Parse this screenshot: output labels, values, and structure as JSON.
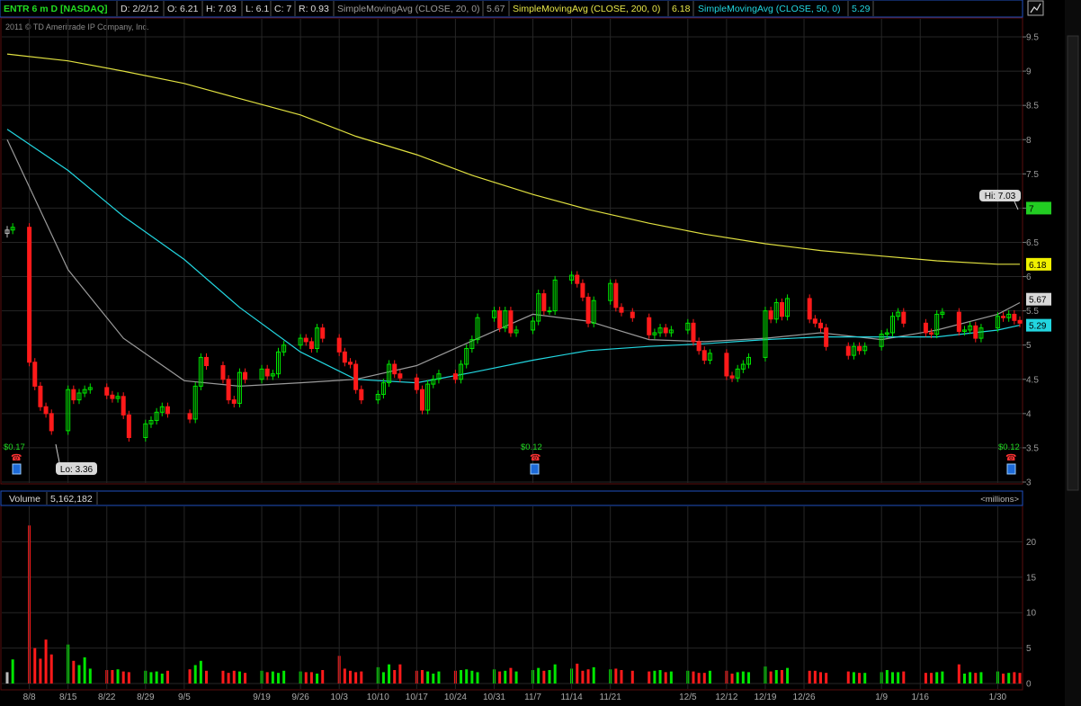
{
  "header": {
    "symbol": "ENTR 6 m D [NASDAQ]",
    "date": "D: 2/2/12",
    "open": "O: 6.21",
    "high": "H: 7.03",
    "low": "L: 6.1",
    "close": "C: 7",
    "range": "R: 0.93",
    "sma20_label": "SimpleMovingAvg (CLOSE, 20, 0)",
    "sma20_value": "5.67",
    "sma200_label": "SimpleMovingAvg (CLOSE, 200, 0)",
    "sma200_value": "6.18",
    "sma50_label": "SimpleMovingAvg (CLOSE, 50, 0)",
    "sma50_value": "5.29"
  },
  "copyright": "2011 © TD Ameritrade IP Company, Inc.",
  "volume_header": {
    "label": "Volume",
    "value": "5,162,182",
    "units": "<millions>"
  },
  "annotations": {
    "hi": "Hi: 7.03",
    "lo": "Lo: 3.36",
    "dividends": [
      "$0.17",
      "$0.12",
      "$0.12"
    ]
  },
  "price_tags": {
    "last": "7",
    "sma200": "6.18",
    "sma20": "5.67",
    "sma50": "5.29"
  },
  "colors": {
    "up": "#00e600",
    "down": "#ff1a1a",
    "neutral": "#bbbbbb",
    "sma20": "#9a9a9a",
    "sma50": "#22d6e0",
    "sma200": "#e0e040",
    "grid": "#262626",
    "border": "#5a0e0e"
  },
  "chart_data": [
    {
      "type": "candlestick",
      "title": "ENTR 6 m D [NASDAQ]",
      "ylim": [
        3,
        9.75
      ],
      "y_ticks": [
        "3",
        "3.5",
        "4",
        "4.5",
        "5",
        "5.5",
        "6",
        "6.5",
        "7",
        "7.5",
        "8",
        "8.5",
        "9",
        "9.5"
      ],
      "x_ticks": [
        "8/8",
        "8/15",
        "8/22",
        "8/29",
        "9/5",
        "9/19",
        "9/26",
        "10/3",
        "10/10",
        "10/17",
        "10/24",
        "10/31",
        "11/7",
        "11/14",
        "11/21",
        "12/5",
        "12/12",
        "12/19",
        "12/26",
        "1/9",
        "1/16",
        "1/30"
      ],
      "x_tick_dates": [
        "2011-08-08",
        "2011-08-15",
        "2011-08-22",
        "2011-08-29",
        "2011-09-05",
        "2011-09-19",
        "2011-09-26",
        "2011-10-03",
        "2011-10-10",
        "2011-10-17",
        "2011-10-24",
        "2011-10-31",
        "2011-11-07",
        "2011-11-14",
        "2011-11-21",
        "2011-12-05",
        "2011-12-12",
        "2011-12-19",
        "2011-12-26",
        "2012-01-09",
        "2012-01-16",
        "2012-01-30"
      ],
      "closes": [
        6.68,
        6.72,
        4.75,
        4.4,
        4.1,
        4.0,
        3.75,
        4.35,
        4.2,
        4.3,
        4.35,
        4.38,
        4.27,
        4.22,
        4.25,
        3.98,
        3.65,
        3.85,
        3.9,
        4.02,
        4.1,
        4.0,
        3.92,
        4.4,
        4.82,
        4.7,
        4.5,
        4.2,
        4.15,
        4.6,
        4.5,
        4.65,
        4.55,
        4.58,
        4.9,
        5.0,
        5.1,
        5.05,
        4.95,
        5.25,
        5.1,
        4.9,
        4.75,
        4.72,
        4.35,
        4.2,
        4.28,
        4.45,
        4.72,
        4.58,
        4.52,
        4.35,
        4.05,
        4.43,
        4.5,
        4.58,
        4.5,
        4.72,
        4.95,
        5.08,
        5.4,
        5.5,
        5.25,
        5.5,
        5.18,
        5.22,
        5.35,
        5.75,
        5.5,
        5.5,
        5.95,
        6.02,
        5.9,
        5.7,
        5.32,
        5.65,
        5.9,
        5.55,
        5.48,
        5.4,
        5.15,
        5.18,
        5.25,
        5.18,
        5.22,
        5.32,
        5.05,
        4.92,
        4.78,
        4.88,
        4.55,
        4.52,
        4.65,
        4.72,
        4.82,
        5.5,
        5.38,
        5.62,
        5.42,
        5.68,
        5.38,
        5.32,
        5.25,
        4.98,
        4.85,
        4.98,
        4.92,
        4.98,
        5.16,
        5.18,
        5.42,
        5.48,
        5.32,
        5.18,
        5.16,
        5.45,
        5.48,
        5.2,
        5.22,
        5.28,
        5.1,
        5.25,
        5.42,
        5.4,
        5.45,
        5.36,
        5.32,
        5.22,
        5.22,
        5.42,
        5.58,
        5.68,
        5.8,
        5.96,
        6.18,
        6.18,
        6.12,
        5.9,
        6.05,
        7.0
      ],
      "series": [
        {
          "name": "SimpleMovingAvg (CLOSE, 20, 0)",
          "x": [
            "2011-08-04",
            "2011-08-15",
            "2011-08-25",
            "2011-09-05",
            "2011-09-15",
            "2011-09-26",
            "2011-10-06",
            "2011-10-17",
            "2011-10-27",
            "2011-11-07",
            "2011-11-17",
            "2011-11-28",
            "2011-12-08",
            "2011-12-19",
            "2011-12-29",
            "2012-01-09",
            "2012-01-19",
            "2012-01-30",
            "2012-02-03"
          ],
          "values": [
            8.0,
            6.1,
            5.1,
            4.48,
            4.4,
            4.45,
            4.5,
            4.7,
            5.06,
            5.45,
            5.35,
            5.08,
            5.05,
            5.1,
            5.18,
            5.08,
            5.22,
            5.45,
            5.62
          ]
        },
        {
          "name": "SimpleMovingAvg (CLOSE, 50, 0)",
          "x": [
            "2011-08-04",
            "2011-08-15",
            "2011-08-25",
            "2011-09-05",
            "2011-09-15",
            "2011-09-26",
            "2011-10-06",
            "2011-10-17",
            "2011-10-27",
            "2011-11-07",
            "2011-11-17",
            "2011-11-28",
            "2011-12-08",
            "2011-12-19",
            "2011-12-29",
            "2012-01-09",
            "2012-01-19",
            "2012-01-30",
            "2012-02-03"
          ],
          "values": [
            8.15,
            7.55,
            6.88,
            6.25,
            5.55,
            4.9,
            4.5,
            4.45,
            4.6,
            4.78,
            4.92,
            4.98,
            5.02,
            5.08,
            5.12,
            5.12,
            5.12,
            5.22,
            5.29
          ]
        },
        {
          "name": "SimpleMovingAvg (CLOSE, 200, 0)",
          "x": [
            "2011-08-04",
            "2011-08-15",
            "2011-08-25",
            "2011-09-05",
            "2011-09-15",
            "2011-09-26",
            "2011-10-06",
            "2011-10-17",
            "2011-10-27",
            "2011-11-07",
            "2011-11-17",
            "2011-11-28",
            "2011-12-08",
            "2011-12-19",
            "2011-12-29",
            "2012-01-09",
            "2012-01-19",
            "2012-01-30",
            "2012-02-03"
          ],
          "values": [
            9.25,
            9.15,
            9.0,
            8.82,
            8.6,
            8.36,
            8.05,
            7.78,
            7.48,
            7.2,
            6.98,
            6.78,
            6.62,
            6.48,
            6.38,
            6.3,
            6.23,
            6.18,
            6.18
          ]
        }
      ],
      "hi": 7.03,
      "lo": 3.36
    },
    {
      "type": "bar",
      "title": "Volume",
      "ylabel": "<millions>",
      "ylim": [
        0,
        25
      ],
      "y_ticks": [
        "0",
        "5",
        "10",
        "15",
        "20"
      ],
      "values": [
        1.6,
        3.4,
        22.3,
        5.0,
        3.5,
        6.2,
        4.1,
        5.5,
        3.2,
        2.6,
        3.7,
        2.1,
        1.9,
        1.9,
        2.0,
        1.7,
        1.6,
        1.8,
        1.6,
        1.7,
        1.4,
        1.8,
        2.0,
        2.6,
        3.2,
        1.8,
        1.8,
        1.5,
        1.8,
        1.7,
        1.5,
        1.8,
        1.6,
        1.7,
        1.5,
        1.8,
        1.7,
        1.6,
        1.6,
        1.4,
        1.9,
        3.9,
        2.1,
        1.8,
        1.6,
        1.7,
        2.3,
        1.6,
        2.7,
        1.9,
        2.7,
        1.8,
        1.9,
        1.7,
        1.4,
        1.7,
        1.8,
        1.9,
        2.0,
        1.8,
        1.6,
        2.0,
        1.7,
        1.8,
        2.2,
        1.7,
        1.9,
        2.2,
        1.8,
        1.9,
        2.7,
        2.1,
        2.8,
        1.8,
        2.0,
        2.3,
        2.0,
        2.1,
        1.9,
        1.8,
        1.7,
        1.8,
        1.9,
        1.6,
        1.7,
        1.8,
        1.7,
        1.5,
        1.5,
        1.8,
        1.8,
        1.4,
        1.6,
        1.7,
        1.6,
        2.4,
        1.7,
        1.9,
        1.9,
        2.2,
        1.8,
        1.8,
        1.6,
        1.5,
        1.7,
        1.6,
        1.5,
        1.5,
        1.6,
        1.9,
        1.6,
        1.6,
        1.7,
        1.5,
        1.5,
        1.6,
        1.7,
        2.7,
        1.4,
        1.6,
        1.5,
        1.6,
        1.7,
        1.4,
        1.5,
        1.6,
        1.5,
        1.6,
        1.7,
        1.8,
        1.9,
        2.0,
        1.8,
        1.9,
        2.0,
        1.9,
        2.0,
        1.3,
        1.5,
        5.2
      ]
    }
  ]
}
